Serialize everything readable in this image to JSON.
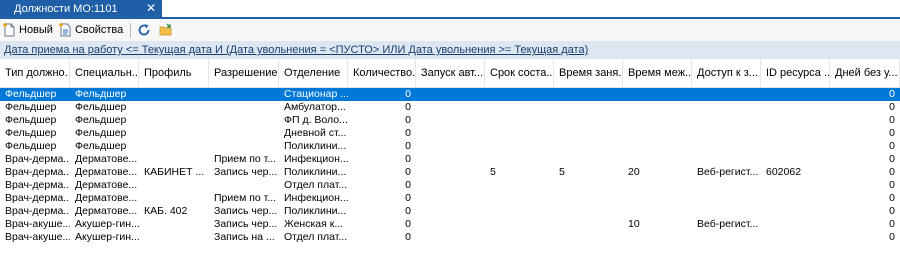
{
  "tab": {
    "title": "Должности МО:1101",
    "close": "✕"
  },
  "toolbar": {
    "new_label": "Новый",
    "properties_label": "Свойства"
  },
  "filter": {
    "text": "Дата приема на работу <=  Текущая дата И (Дата увольнения = <ПУСТО> ИЛИ Дата увольнения >=  Текущая дата)"
  },
  "grid": {
    "columns": [
      "Тип должно...",
      "Специальн...",
      "Профиль",
      "Разрешение",
      "Отделение",
      "Количество...",
      "Запуск авт...",
      "Срок соста...",
      "Время заня...",
      "Время меж...",
      "Доступ к з...",
      "ID ресурса ...",
      "Дней без у..."
    ],
    "rows": [
      [
        "Фельдшер",
        "Фельдшер",
        "",
        "",
        "Стационар ...",
        "0",
        "",
        "",
        "",
        "",
        "",
        "",
        "0"
      ],
      [
        "Фельдшер",
        "Фельдшер",
        "",
        "",
        "Амбулатор...",
        "0",
        "",
        "",
        "",
        "",
        "",
        "",
        "0"
      ],
      [
        "Фельдшер",
        "Фельдшер",
        "",
        "",
        "ФП д. Воло...",
        "0",
        "",
        "",
        "",
        "",
        "",
        "",
        "0"
      ],
      [
        "Фельдшер",
        "Фельдшер",
        "",
        "",
        "Дневной ст...",
        "0",
        "",
        "",
        "",
        "",
        "",
        "",
        "0"
      ],
      [
        "Фельдшер",
        "Фельдшер",
        "",
        "",
        "Поликлини...",
        "0",
        "",
        "",
        "",
        "",
        "",
        "",
        "0"
      ],
      [
        "Врач-дерма...",
        "Дерматове...",
        "",
        "Прием по т...",
        "Инфекцион...",
        "0",
        "",
        "",
        "",
        "",
        "",
        "",
        "0"
      ],
      [
        "Врач-дерма...",
        "Дерматове...",
        "КАБИНЕТ ...",
        "Запись чер...",
        "Поликлини...",
        "0",
        "",
        "5",
        "5",
        "20",
        "Веб-регист...",
        "602062",
        "0"
      ],
      [
        "Врач-дерма...",
        "Дерматове...",
        "",
        "",
        "Отдел плат...",
        "0",
        "",
        "",
        "",
        "",
        "",
        "",
        "0"
      ],
      [
        "Врач-дерма...",
        "Дерматове...",
        "",
        "Прием по т...",
        "Инфекцион...",
        "0",
        "",
        "",
        "",
        "",
        "",
        "",
        "0"
      ],
      [
        "Врач-дерма...",
        "Дерматове...",
        "КАБ. 402",
        "Запись чер...",
        "Поликлини...",
        "0",
        "",
        "",
        "",
        "",
        "",
        "",
        "0"
      ],
      [
        "Врач-акуше...",
        "Акушер-гин...",
        "",
        "Запись чер...",
        "Женская к...",
        "0",
        "",
        "",
        "",
        "10",
        "Веб-регист...",
        "",
        "0"
      ],
      [
        "Врач-акуше...",
        "Акушер-гин...",
        "",
        "Запись на ...",
        "Отдел плат...",
        "0",
        "",
        "",
        "",
        "",
        "",
        "",
        "0"
      ]
    ]
  },
  "colors": {
    "accent": "#1f5fa8",
    "selection": "#0078d7",
    "filter_bg": "#dde6f1"
  }
}
